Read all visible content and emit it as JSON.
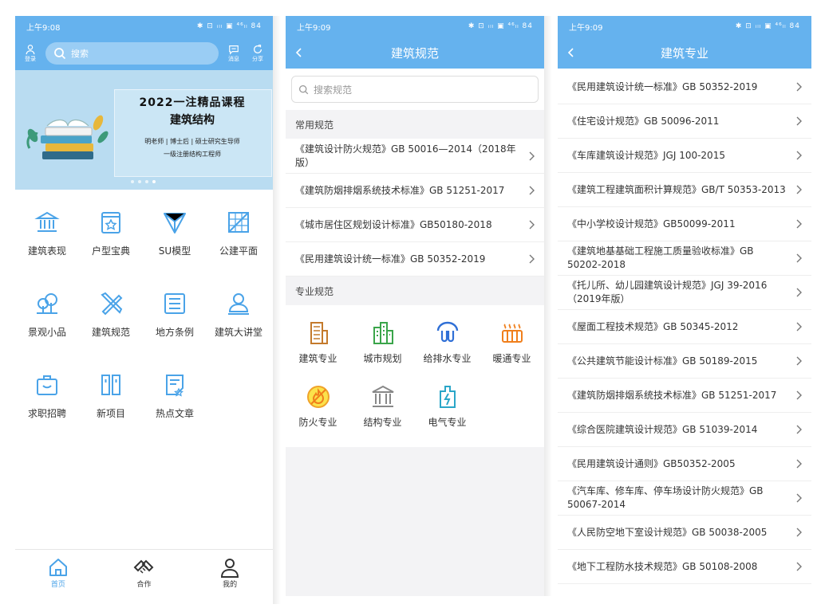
{
  "phone1": {
    "status": {
      "time": "上午9:08",
      "icons": "✱ ⊡ ᵢₗₗ ▣ ⁴⁶ₗₗ 84"
    },
    "header": {
      "login_label": "登录",
      "search_placeholder": "搜索",
      "message_label": "消息",
      "share_label": "分享"
    },
    "banner": {
      "title": "2022一注精品课程",
      "subtitle": "建筑结构",
      "line1": "明老师 | 博士后 | 硕士研究生导师",
      "line2": "一级注册结构工程师"
    },
    "grid": [
      {
        "label": "建筑表现",
        "icon": "bank-icon"
      },
      {
        "label": "户型宝典",
        "icon": "star-book-icon"
      },
      {
        "label": "SU模型",
        "icon": "triangle-icon"
      },
      {
        "label": "公建平面",
        "icon": "grid-frame-icon"
      },
      {
        "label": "景观小品",
        "icon": "tree-icon"
      },
      {
        "label": "建筑规范",
        "icon": "ruler-pencil-icon"
      },
      {
        "label": "地方条例",
        "icon": "list-doc-icon"
      },
      {
        "label": "建筑大讲堂",
        "icon": "lecturer-icon"
      },
      {
        "label": "求职招聘",
        "icon": "briefcase-icon"
      },
      {
        "label": "新项目",
        "icon": "columns-icon"
      },
      {
        "label": "热点文章",
        "icon": "article-star-icon"
      }
    ],
    "tabs": [
      {
        "label": "首页",
        "icon": "home-icon",
        "active": true
      },
      {
        "label": "合作",
        "icon": "handshake-icon",
        "active": false
      },
      {
        "label": "我的",
        "icon": "user-icon",
        "active": false
      }
    ]
  },
  "phone2": {
    "status": {
      "time": "上午9:09",
      "icons": "✱ ⊡ ᵢₗₗ ▣ ⁴⁶ₗₗ 84"
    },
    "title": "建筑规范",
    "search_placeholder": "搜索规范",
    "common_title": "常用规范",
    "common": [
      "《建筑设计防火规范》GB 50016—2014（2018年版）",
      "《建筑防烟排烟系统技术标准》GB 51251-2017",
      "《城市居住区规划设计标准》GB50180-2018",
      "《民用建筑设计统一标准》GB 50352-2019"
    ],
    "pro_title": "专业规范",
    "categories": [
      {
        "label": "建筑专业",
        "icon": "building-icon"
      },
      {
        "label": "城市规划",
        "icon": "city-icon"
      },
      {
        "label": "给排水专业",
        "icon": "water-pipe-icon"
      },
      {
        "label": "暖通专业",
        "icon": "heater-icon"
      },
      {
        "label": "防火专业",
        "icon": "fire-icon"
      },
      {
        "label": "结构专业",
        "icon": "pillars-icon"
      },
      {
        "label": "电气专业",
        "icon": "electric-icon"
      }
    ]
  },
  "phone3": {
    "status": {
      "time": "上午9:09",
      "icons": "✱ ⊡ ᵢₗₗ ▣ ⁴⁶ₗₗ 84"
    },
    "title": "建筑专业",
    "items": [
      "《民用建筑设计统一标准》GB 50352-2019",
      "《住宅设计规范》GB 50096-2011",
      "《车库建筑设计规范》JGJ 100-2015",
      "《建筑工程建筑面积计算规范》GB/T 50353-2013",
      "《中小学校设计规范》GB50099-2011",
      "《建筑地基基础工程施工质量验收标准》GB 50202-2018",
      "《托儿所、幼儿园建筑设计规范》JGJ 39-2016（2019年版）",
      "《屋面工程技术规范》GB 50345-2012",
      "《公共建筑节能设计标准》GB 50189-2015",
      "《建筑防烟排烟系统技术标准》GB 51251-2017",
      "《综合医院建筑设计规范》GB 51039-2014",
      "《民用建筑设计通则》GB50352-2005",
      "《汽车库、修车库、停车场设计防火规范》GB 50067-2014",
      "《人民防空地下室设计规范》GB 50038-2005",
      "《地下工程防水技术规范》GB 50108-2008"
    ]
  },
  "colors": {
    "primary": "#65b2ee",
    "icon_blue": "#4aa3e8"
  }
}
